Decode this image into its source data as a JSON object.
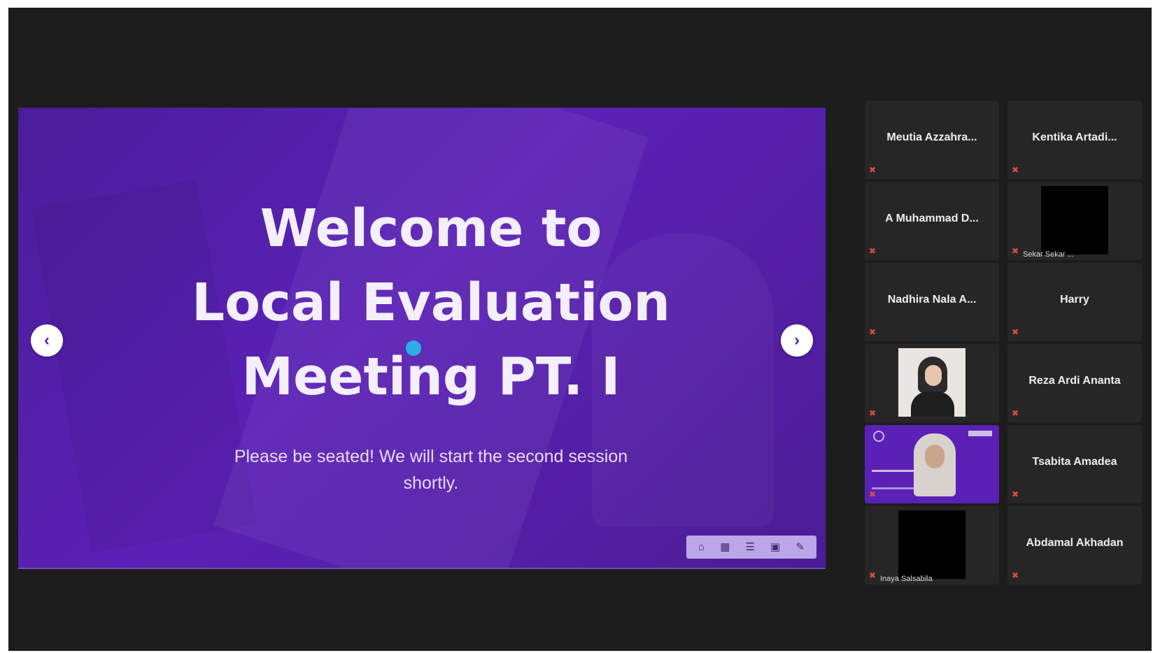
{
  "presentation": {
    "title_lines": [
      "Welcome to",
      "Local Evaluation",
      "Meeting PT. I"
    ],
    "subtitle_lines": [
      "Please be seated! We will start the second session",
      "shortly."
    ],
    "prev_icon": "chevron-left-icon",
    "next_icon": "chevron-right-icon",
    "toolbar_icons": [
      "home-icon",
      "grid-icon",
      "menu-icon",
      "image-icon",
      "pen-icon"
    ]
  },
  "participants": [
    {
      "name": "Meutia Azzahra...",
      "video": "none",
      "muted": true
    },
    {
      "name": "Kentika Artadi...",
      "video": "none",
      "muted": true
    },
    {
      "name": "A Muhammad D...",
      "video": "none",
      "muted": true
    },
    {
      "name": "",
      "video": "black",
      "caption": "Sekar Sekar ...",
      "muted": true
    },
    {
      "name": "Nadhira Nala A...",
      "video": "none",
      "muted": true
    },
    {
      "name": "Harry",
      "video": "none",
      "muted": true
    },
    {
      "name": "",
      "video": "photo",
      "caption": "",
      "muted": true
    },
    {
      "name": "Reza Ardi Ananta",
      "video": "none",
      "muted": true
    },
    {
      "name": "",
      "video": "screen",
      "caption": "",
      "muted": true
    },
    {
      "name": "Tsabita Amadea",
      "video": "none",
      "muted": true
    },
    {
      "name": "",
      "video": "black",
      "caption": "Inaya Salsabila",
      "muted": true
    },
    {
      "name": "Abdamal Akhadan",
      "video": "none",
      "muted": true
    }
  ],
  "colors": {
    "background": "#1c1c1c",
    "slide": "#5b21b6",
    "pointer": "#2eaee6",
    "tile": "#262626",
    "muted_icon": "#e04a4a"
  }
}
